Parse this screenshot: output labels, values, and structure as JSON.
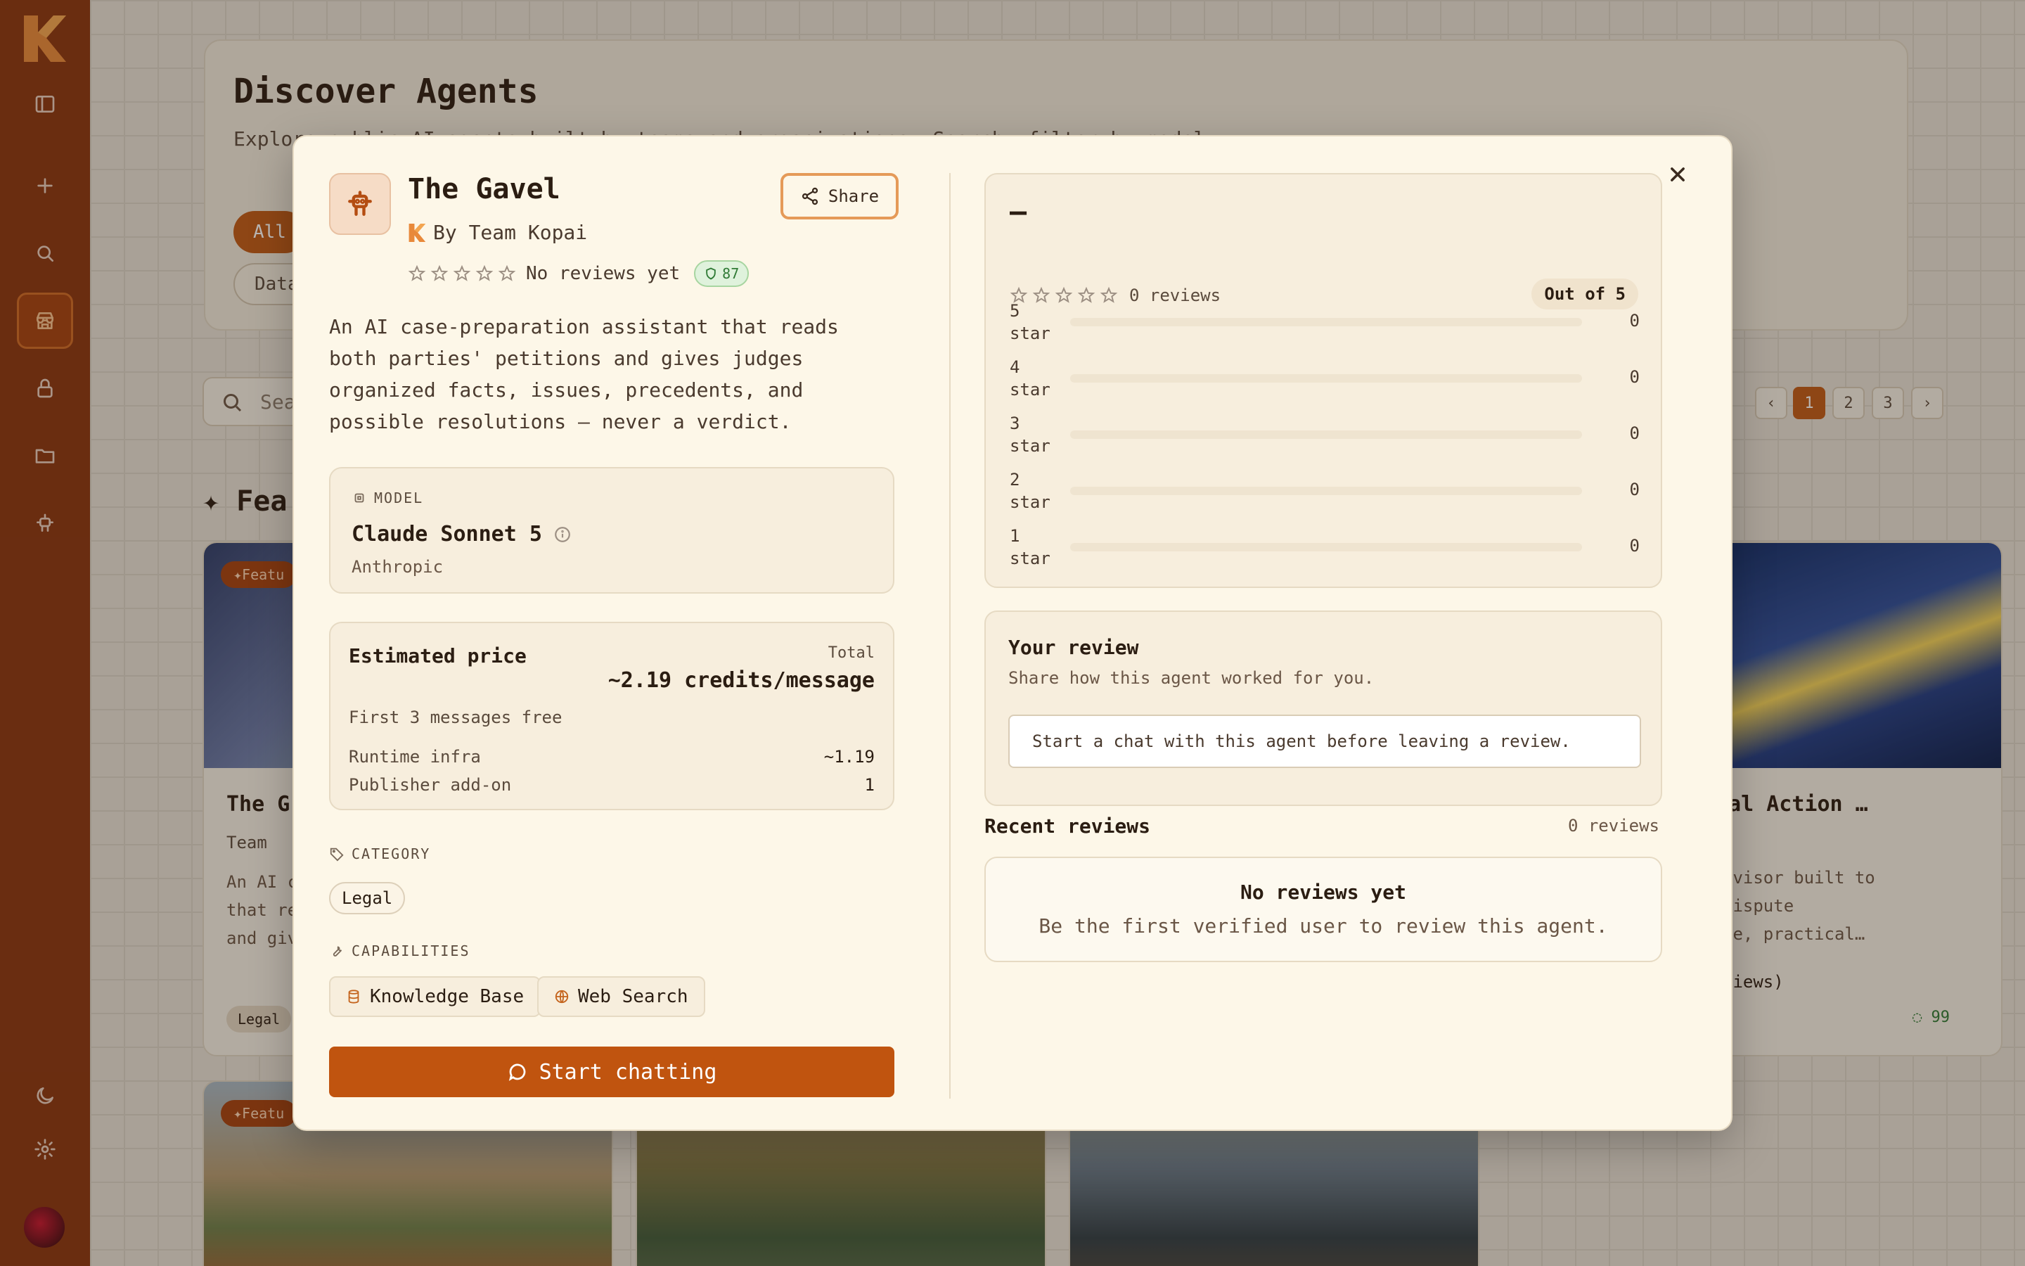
{
  "background": {
    "hero_title": "Discover Agents",
    "hero_desc": "Explore public AI agents built by teams and organizations. Search, filter by model",
    "pill_all": "All",
    "pill_data": "Data",
    "search_placeholder": "Sea",
    "pages": [
      "1",
      "2",
      "3"
    ],
    "featured_heading": "Fea",
    "badge_featured": "Featu",
    "card_left_title": "The G",
    "card_left_by": "Team",
    "card_left_desc": "An AI c\nthat re\nand giv",
    "card_left_tag": "Legal",
    "card_right_title": "gal Action …",
    "card_right_desc": "dvisor built to\ndispute\nve, practical…",
    "card_right_reviews": "views)",
    "card_right_score": "99"
  },
  "agent": {
    "name": "The Gavel",
    "by": "By Team Kopai",
    "rating_text": "No reviews yet",
    "score": "87",
    "share_label": "Share",
    "description": "An AI case-preparation assistant that reads both parties' petitions and gives judges organized facts, issues, precedents, and possible resolutions — never a verdict."
  },
  "model": {
    "label": "MODEL",
    "name": "Claude Sonnet 5",
    "provider": "Anthropic"
  },
  "price": {
    "title": "Estimated price",
    "total_label": "Total",
    "total_value": "~2.19 credits/message",
    "free_note": "First 3 messages free",
    "lines": [
      {
        "label": "Runtime infra",
        "value": "~1.19"
      },
      {
        "label": "Publisher add-on",
        "value": "1"
      }
    ]
  },
  "category": {
    "label": "CATEGORY",
    "value": "Legal"
  },
  "capabilities": {
    "label": "CAPABILITIES",
    "items": [
      "Knowledge Base",
      "Web Search"
    ]
  },
  "start_button": "Start chatting",
  "ratings": {
    "average": "—",
    "reviews_count": "0 reviews",
    "out_of": "Out of 5",
    "bars": [
      {
        "label": "5 star",
        "count": "0",
        "fraction": 0
      },
      {
        "label": "4 star",
        "count": "0",
        "fraction": 0
      },
      {
        "label": "3 star",
        "count": "0",
        "fraction": 0
      },
      {
        "label": "2 star",
        "count": "0",
        "fraction": 0
      },
      {
        "label": "1 star",
        "count": "0",
        "fraction": 0
      }
    ]
  },
  "your_review": {
    "title": "Your review",
    "subtitle": "Share how this agent worked for you.",
    "input_text": "Start a chat with this agent before leaving a review."
  },
  "recent": {
    "title": "Recent reviews",
    "count": "0 reviews",
    "empty_title": "No reviews yet",
    "empty_sub": "Be the first verified user to review this agent."
  },
  "colors": {
    "accent": "#c0540f",
    "sidebar": "#8a3510",
    "modal_bg": "#fdf7e8"
  }
}
